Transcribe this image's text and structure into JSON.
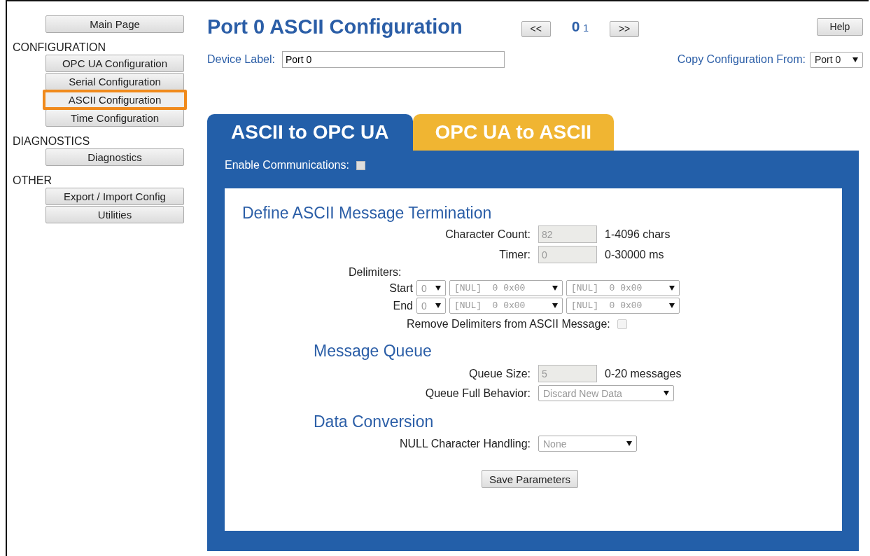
{
  "sidebar": {
    "main_button": {
      "label": "Main Page"
    },
    "sections": [
      {
        "heading": "CONFIGURATION",
        "items": [
          {
            "label": "OPC UA Configuration",
            "selected": false
          },
          {
            "label": "Serial Configuration",
            "selected": false
          },
          {
            "label": "ASCII Configuration",
            "selected": true
          },
          {
            "label": "Time Configuration",
            "selected": false
          }
        ]
      },
      {
        "heading": "DIAGNOSTICS",
        "items": [
          {
            "label": "Diagnostics",
            "selected": false
          }
        ]
      },
      {
        "heading": "OTHER",
        "items": [
          {
            "label": "Export / Import Config",
            "selected": false
          },
          {
            "label": "Utilities",
            "selected": false
          }
        ]
      }
    ]
  },
  "header": {
    "title": "Port 0 ASCII Configuration",
    "prev": "<<",
    "pages": [
      {
        "label": "0",
        "selected": true
      },
      {
        "label": "1",
        "selected": false
      }
    ],
    "next": ">>",
    "help": "Help"
  },
  "device_label": {
    "label": "Device Label:",
    "value": "Port 0"
  },
  "copy_from": {
    "label": "Copy Configuration From:",
    "value": "Port 0"
  },
  "tabs": [
    {
      "label": "ASCII to OPC UA",
      "selected": true
    },
    {
      "label": "OPC UA to ASCII",
      "selected": false
    }
  ],
  "enable_communications": {
    "label": "Enable Communications:",
    "checked": false
  },
  "sections": [
    {
      "title": "Define ASCII Message Termination",
      "rows": [
        {
          "kind": "text",
          "label": "Character Count:",
          "value": "82",
          "hint": "1-4096 chars",
          "disabled": true
        },
        {
          "kind": "text",
          "label": "Timer:",
          "value": "0",
          "hint": "0-30000 ms",
          "disabled": true
        },
        {
          "kind": "heading",
          "label": "Delimiters:"
        },
        {
          "kind": "delimiter",
          "label": "Start",
          "count": "0",
          "selects": [
            "[NUL]  0 0x00",
            "[NUL]  0 0x00"
          ]
        },
        {
          "kind": "delimiter",
          "label": "End",
          "count": "0",
          "selects": [
            "[NUL]  0 0x00",
            "[NUL]  0 0x00"
          ]
        },
        {
          "kind": "checkbox",
          "label": "Remove Delimiters from ASCII Message:",
          "checked": false
        }
      ]
    },
    {
      "title": "Message Queue",
      "rows": [
        {
          "kind": "text",
          "label": "Queue Size:",
          "value": "5",
          "hint": "0-20 messages",
          "disabled": true
        },
        {
          "kind": "select",
          "label": "Queue Full Behavior:",
          "value": "Discard New Data",
          "disabled": true
        }
      ]
    },
    {
      "title": "Data Conversion",
      "rows": [
        {
          "kind": "select",
          "label": "NULL Character Handling:",
          "value": "None",
          "disabled": true
        }
      ]
    }
  ],
  "save_button": "Save Parameters"
}
